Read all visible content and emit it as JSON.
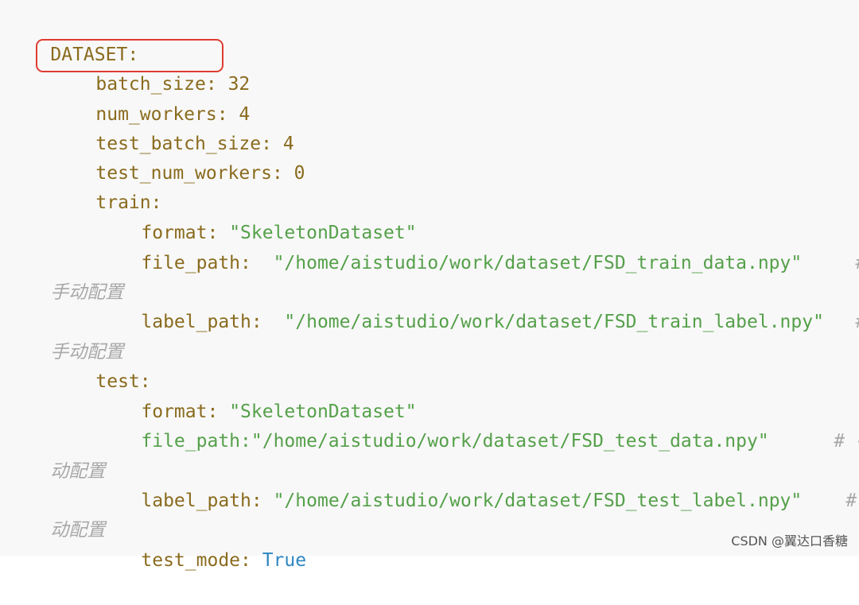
{
  "code": {
    "dataset_key": "DATASET",
    "batch_size_key": "batch_size",
    "batch_size_value": "32",
    "num_workers_key": "num_workers",
    "num_workers_value": "4",
    "test_batch_size_key": "test_batch_size",
    "test_batch_size_value": "4",
    "test_num_workers_key": "test_num_workers",
    "test_num_workers_value": "0",
    "train_key": "train",
    "train_format_key": "format",
    "train_format_value": "\"SkeletonDataset\"",
    "train_file_path_key": "file_path",
    "train_file_path_value": "\"/home/aistudio/work/dataset/FSD_train_data.npy\"",
    "train_file_path_comment_a": "#",
    "train_file_path_comment_b": "手动配置",
    "train_label_path_key": "label_path",
    "train_label_path_value": "\"/home/aistudio/work/dataset/FSD_train_label.npy\"",
    "train_label_path_comment_a": "#",
    "train_label_path_comment_b": "手动配置",
    "test_key": "test",
    "test_format_key": "format",
    "test_format_value": "\"SkeletonDataset\"",
    "test_file_path_key": "file_path",
    "test_file_path_value": "\"/home/aistudio/work/dataset/FSD_test_data.npy\"",
    "test_file_path_comment_a": "# 手",
    "test_file_path_comment_b": "动配置",
    "test_label_path_key": "label_path",
    "test_label_path_value": "\"/home/aistudio/work/dataset/FSD_test_label.npy\"",
    "test_label_path_comment_a": "# 手",
    "test_label_path_comment_b": "动配置",
    "test_mode_key": "test_mode",
    "test_mode_value": "True"
  },
  "watermark": "CSDN @翼达口香糖",
  "highlight_color": "#e03c31"
}
